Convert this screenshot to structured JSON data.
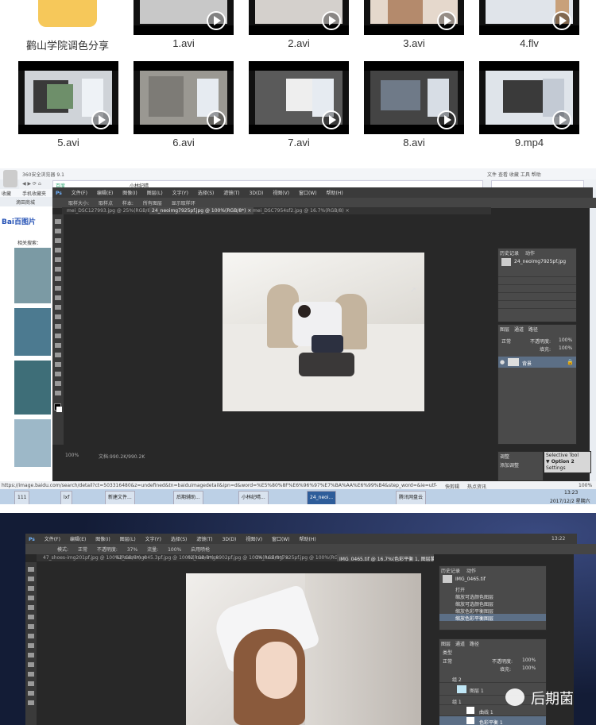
{
  "video_grid": {
    "folder_label": "鹳山学院调色分享",
    "row1_labels": [
      "1.avi",
      "2.avi",
      "3.avi",
      "4.flv"
    ],
    "row2_labels": [
      "5.avi",
      "6.avi",
      "7.avi",
      "8.avi",
      "9.mp4"
    ]
  },
  "browser": {
    "title": "360安全浏览器 9.1",
    "menu": [
      "文件",
      "查看",
      "收藏",
      "工具",
      "帮助"
    ],
    "fav_items": [
      "收藏",
      "手机收藏夹",
      "滴田商城"
    ],
    "tab_title": "小林纪晴",
    "address_prefix": "百度",
    "status_url": "https://image.baidu.com/search/detail?ct=503316480&z=undefined&tn=baiduimagedetail&ipn=d&word=%E5%80%8F%E6%96%97%E7%BA%AA%E6%99%B4&step_word=&ie=utf-8&in=&cl",
    "status_right": "快剪辑",
    "status_right2": "热点资讯",
    "baidu_logo": "Bai百图片",
    "baidu_related": "相关搜索：",
    "zoom": "100%"
  },
  "photoshop_1": {
    "menu": [
      "文件(F)",
      "编辑(E)",
      "图像(I)",
      "图层(L)",
      "文字(Y)",
      "选择(S)",
      "滤镜(T)",
      "3D(D)",
      "视图(V)",
      "窗口(W)",
      "帮助(H)"
    ],
    "options": [
      "取样大小:",
      "取样点",
      "样本:",
      "所有图层",
      "显示取样环"
    ],
    "doc_tabs": [
      "mei_DSC127993.jpg @ 25%(RGB/8) ×",
      "24_neoimg7925pf.jpg @ 100%(RGB/8*) ×",
      "mei_DSC7954sf2.jpg @ 16.7%(RGB/8) ×"
    ],
    "history_tabs": [
      "历史记录",
      "动作"
    ],
    "history_items": [
      "24_neoimg7925pf.jpg"
    ],
    "layers_tabs": [
      "图层",
      "通道",
      "路径"
    ],
    "layer_blend": "正常",
    "layer_opacity_label": "不透明度:",
    "layer_opacity": "100%",
    "layer_fill_label": "填充:",
    "layer_fill": "100%",
    "layer_name": "背景",
    "status": "100%",
    "doc_size": "文档:990.2K/990.2K",
    "panel2_title": "Selective Tool",
    "panel2_rows": [
      "▼ Option 2",
      "Setting",
      "Settings"
    ],
    "adjust_tab": "调整",
    "adjust_add": "添加调整"
  },
  "taskbar": {
    "items": [
      "111",
      "lxf",
      "新建文件...",
      "",
      "",
      "后期辅助...",
      "",
      "小林纪晴...",
      "",
      "24_neoi...",
      "",
      "",
      "腾讯网盘云"
    ],
    "clock_time": "13:23",
    "clock_date": "2017/12/2 星期六"
  },
  "photoshop_2": {
    "menu": [
      "文件(F)",
      "编辑(E)",
      "图像(I)",
      "图层(L)",
      "文字(Y)",
      "选择(S)",
      "滤镜(T)",
      "3D(D)",
      "视图(V)",
      "窗口(W)",
      "帮助(H)"
    ],
    "options": [
      "模式:",
      "正常",
      "不透明度:",
      "37%",
      "流量:",
      "100%",
      "启用喷枪"
    ],
    "doc_tabs": [
      "47_shoes-img201pf.jpg @ 100%(RGB/8*) ×",
      "62_neo-img845.3pf.jpg @ 100%(RGB/8*) ×",
      "62_neo-img8902pf.jpg @ 100%(RGB/8*) ×",
      "24_neoimg7925pf.jpg @ 100%(RGB/8*) ×",
      "IMG_0465.tif @ 16.7%(色彩平衡 1, 图层蒙版/8) ×"
    ],
    "history_tabs": [
      "历史记录",
      "动作"
    ],
    "history_file": "IMG_0465.tif",
    "history_items": [
      "打开",
      "缩放可选颜色图层",
      "缩放可选颜色图层",
      "缩放色彩平衡图层",
      "缩放色彩平衡图层"
    ],
    "layers_tabs": [
      "图层",
      "通道",
      "路径"
    ],
    "layer_kind": "类型",
    "layer_blend": "正常",
    "layer_opacity_label": "不透明度:",
    "layer_opacity": "100%",
    "layer_fill_label": "填充:",
    "layer_fill": "100%",
    "layer_items": [
      "组 2",
      "图层 1",
      "组 1",
      "曲线 1",
      "色彩平衡 1"
    ],
    "clock": "13:22"
  },
  "watermark": "后期菌",
  "colors": {
    "ps_bg": "#282828",
    "ps_panel": "#4a4a4a",
    "folder": "#f6c85a",
    "desktop_blue": "#1b2a4e"
  }
}
